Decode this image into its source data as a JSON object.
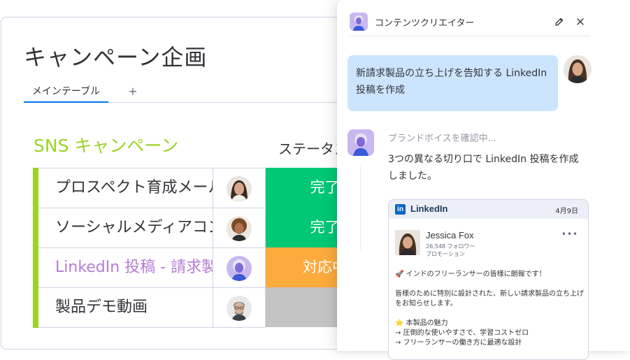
{
  "board": {
    "title": "キャンペーン企画",
    "tab_main": "メインテーブル",
    "tab_add": "+",
    "group_title": "SNS キャンペーン",
    "status_header": "ステータス",
    "group_color": "#9cd326",
    "rows": [
      {
        "name": "プロスペクト育成メール",
        "status": "完了",
        "status_color": "#00c875",
        "person": "woman-long-hair"
      },
      {
        "name": "ソーシャルメディアコンテンツ",
        "status": "完了",
        "status_color": "#00c875",
        "person": "woman-curly-hair"
      },
      {
        "name": "LinkedIn 投稿 - 請求製品",
        "status": "対応中",
        "status_color": "#fdab3d",
        "person": "ai-agent"
      },
      {
        "name": "製品デモ動画",
        "status": "",
        "status_color": "#c4c4c4",
        "person": "man-glasses"
      }
    ]
  },
  "panel": {
    "title": "コンテンツクリエイター",
    "edit_icon": "edit-icon",
    "close_icon": "close-icon",
    "user_message": "新請求製品の立ち上げを告知する LinkedIn 投稿を作成",
    "thinking": "ブランドボイスを確認中...",
    "agent_message": "3つの異なる切り口で LinkedIn 投稿を作成しました。",
    "linkedin": {
      "brand": "LinkedIn",
      "date": "4月9日",
      "author": "Jessica Fox",
      "followers": "26,548 フォロワー",
      "tag": "プロモーション",
      "more": "•••",
      "body_line1": "🚀 インドのフリーランサーの皆様に朗報です！",
      "body_line2": "皆様のために特別に設計された、新しい請求製品の立ち上げをお知らせします。",
      "body_line3": "⭐ 本製品の魅力",
      "body_line4": "→ 圧倒的な使いやすさで、学習コストゼロ",
      "body_line5": "→ フリーランサーの働き方に最適な設計"
    }
  }
}
